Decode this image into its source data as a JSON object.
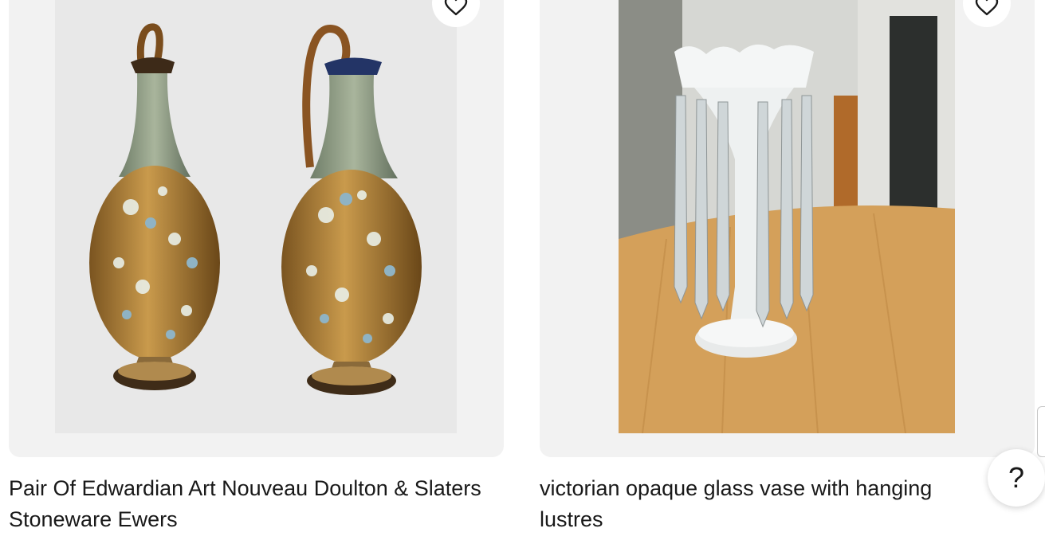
{
  "listings": [
    {
      "title": "Pair Of Edwardian Art Nouveau Doulton & Slaters Stoneware Ewers",
      "image_alt": "Two brown and green floral stoneware ewers"
    },
    {
      "title": "victorian opaque glass vase with hanging lustres",
      "image_alt": "White opaque glass vase with crystal drops on a wooden table"
    }
  ],
  "icons": {
    "watch": "heart-icon",
    "help": "question-mark-icon"
  },
  "help": {
    "label": "?"
  },
  "colors": {
    "card_bg": "#f2f2f2",
    "text": "#191919"
  }
}
